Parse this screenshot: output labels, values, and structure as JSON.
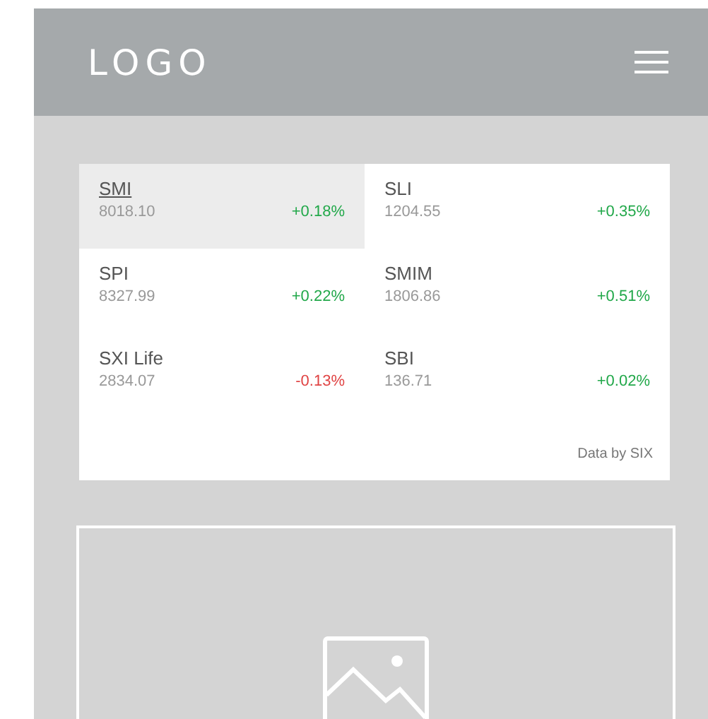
{
  "header": {
    "logo": "LOGO"
  },
  "indices": [
    {
      "name": "SMI",
      "value": "8018.10",
      "change": "+0.18%",
      "color": "#22a84a",
      "selected": true
    },
    {
      "name": "SLI",
      "value": "1204.55",
      "change": "+0.35%",
      "color": "#22a84a",
      "selected": false
    },
    {
      "name": "SPI",
      "value": "8327.99",
      "change": "+0.22%",
      "color": "#22a84a",
      "selected": false
    },
    {
      "name": "SMIM",
      "value": "1806.86",
      "change": "+0.51%",
      "color": "#22a84a",
      "selected": false
    },
    {
      "name": "SXI Life",
      "value": "2834.07",
      "change": "-0.13%",
      "color": "#e04444",
      "selected": false
    },
    {
      "name": "SBI",
      "value": "136.71",
      "change": "+0.02%",
      "color": "#22a84a",
      "selected": false
    }
  ],
  "source": "Data by SIX",
  "media": {
    "kind": "image-placeholder"
  }
}
